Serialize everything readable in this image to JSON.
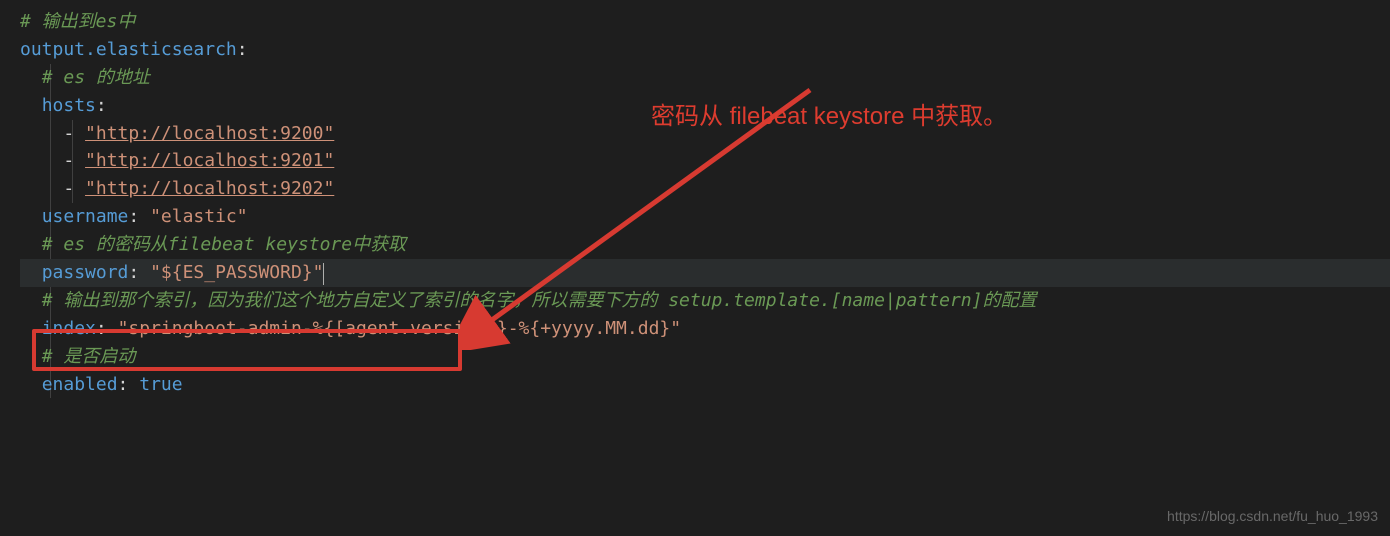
{
  "code": {
    "comment_output_es": "# 输出到es中",
    "output_key": "output.elasticsearch",
    "comment_es_addr": "# es 的地址",
    "hosts_key": "hosts",
    "host_dash": "- ",
    "host1": "\"http://localhost:9200\"",
    "host2": "\"http://localhost:9201\"",
    "host3": "\"http://localhost:9202\"",
    "username_key": "username",
    "username_val": "\"elastic\"",
    "comment_password": "# es 的密码从filebeat keystore中获取",
    "password_key": "password",
    "password_val": "\"${ES_PASSWORD}\"",
    "comment_index": "# 输出到那个索引，因为我们这个地方自定义了索引的名字，所以需要下方的 setup.template.[name|pattern]的配置",
    "index_key": "index",
    "index_val": "\"springboot-admin-%{[agent.version]}-%{+yyyy.MM.dd}\"",
    "comment_enabled": "# 是否启动",
    "enabled_key": "enabled",
    "enabled_val": "true",
    "colon": ":"
  },
  "annotation": {
    "text": "密码从 filebeat keystore 中获取。"
  },
  "watermark": "https://blog.csdn.net/fu_huo_1993"
}
